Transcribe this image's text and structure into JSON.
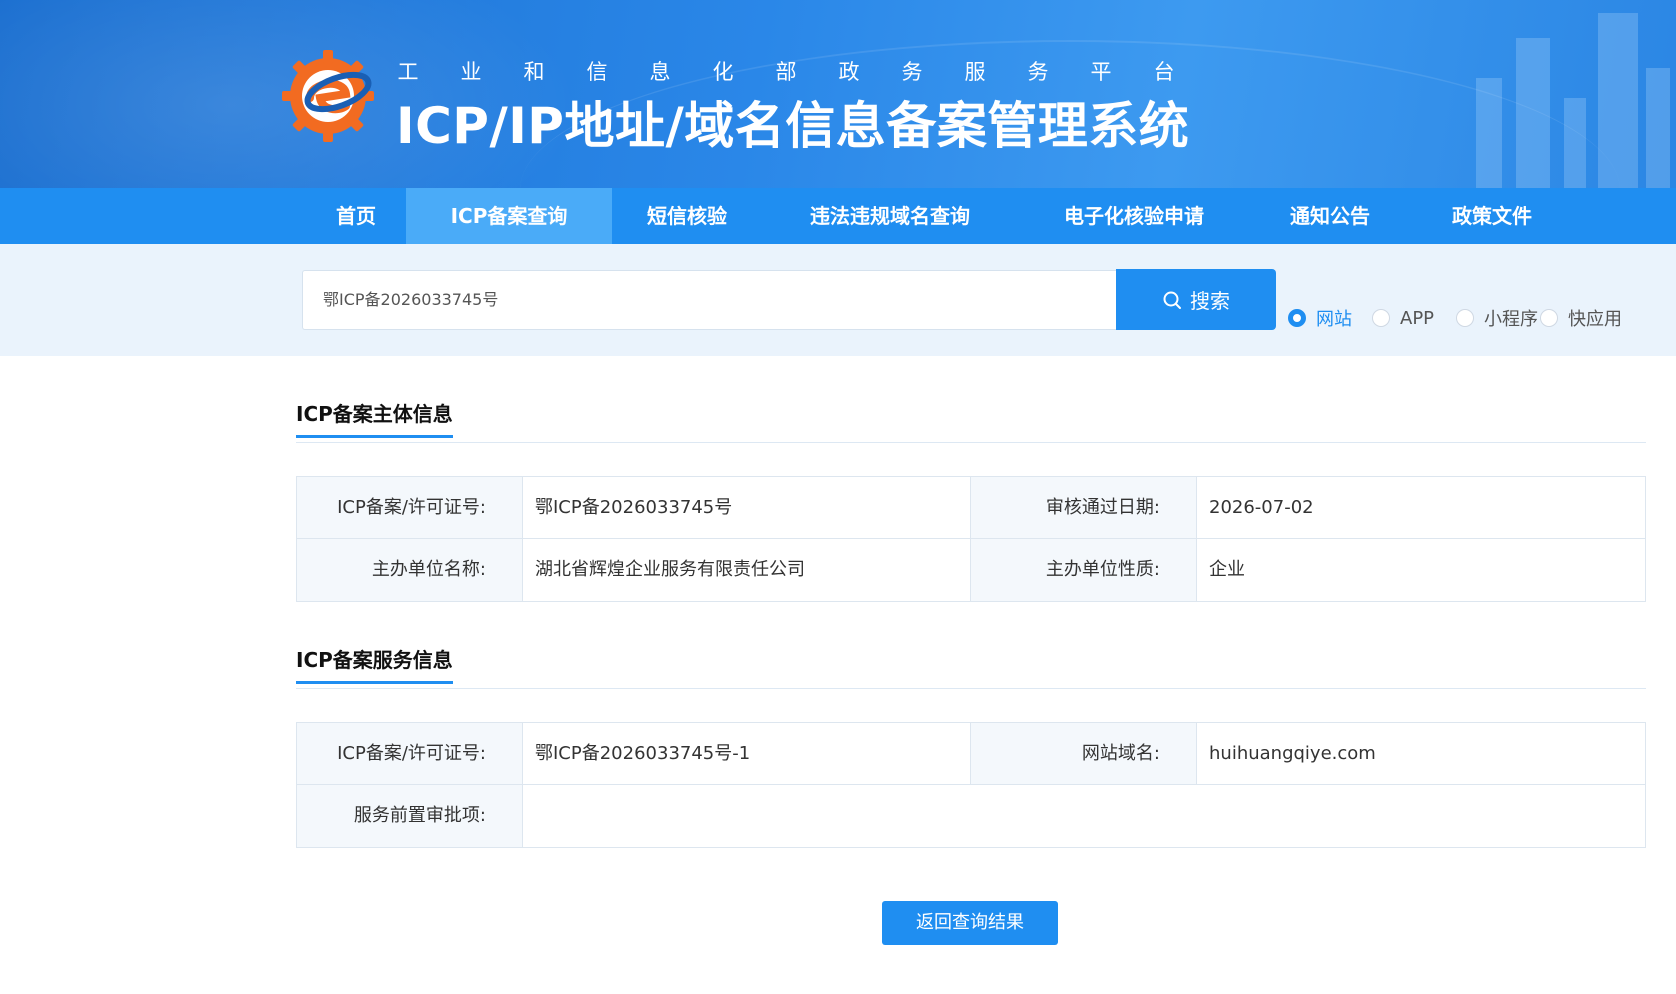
{
  "header": {
    "subtitle_chars": [
      "工",
      "业",
      "和",
      "信",
      "息",
      "化",
      "部",
      "政",
      "务",
      "服",
      "务",
      "平",
      "台"
    ],
    "title": "ICP/IP地址/域名信息备案管理系统"
  },
  "nav": {
    "items": [
      {
        "label": "首页",
        "active": false
      },
      {
        "label": "ICP备案查询",
        "active": true
      },
      {
        "label": "短信核验",
        "active": false
      },
      {
        "label": "违法违规域名查询",
        "active": false
      },
      {
        "label": "电子化核验申请",
        "active": false
      },
      {
        "label": "通知公告",
        "active": false
      },
      {
        "label": "政策文件",
        "active": false
      }
    ]
  },
  "search": {
    "value": "鄂ICP备2026033745号",
    "button_label": "搜索",
    "options": [
      {
        "label": "网站",
        "checked": true
      },
      {
        "label": "APP",
        "checked": false
      },
      {
        "label": "小程序",
        "checked": false
      },
      {
        "label": "快应用",
        "checked": false
      }
    ]
  },
  "subject_section": {
    "title": "ICP备案主体信息",
    "rows": [
      {
        "k1": "ICP备案/许可证号:",
        "v1": "鄂ICP备2026033745号",
        "k2": "审核通过日期:",
        "v2": "2026-07-02"
      },
      {
        "k1": "主办单位名称:",
        "v1": "湖北省辉煌企业服务有限责任公司",
        "k2": "主办单位性质:",
        "v2": "企业"
      }
    ]
  },
  "service_section": {
    "title": "ICP备案服务信息",
    "row1": {
      "k1": "ICP备案/许可证号:",
      "v1": "鄂ICP备2026033745号-1",
      "k2": "网站域名:",
      "v2": "huihuangqiye.com"
    },
    "row2": {
      "k1": "服务前置审批项:",
      "v1": ""
    }
  },
  "back_button": "返回查询结果",
  "colors": {
    "primary": "#1f8ef1",
    "nav_active": "#4aabf8",
    "banner": "#2a87e8",
    "logo_orange": "#f26b21"
  }
}
